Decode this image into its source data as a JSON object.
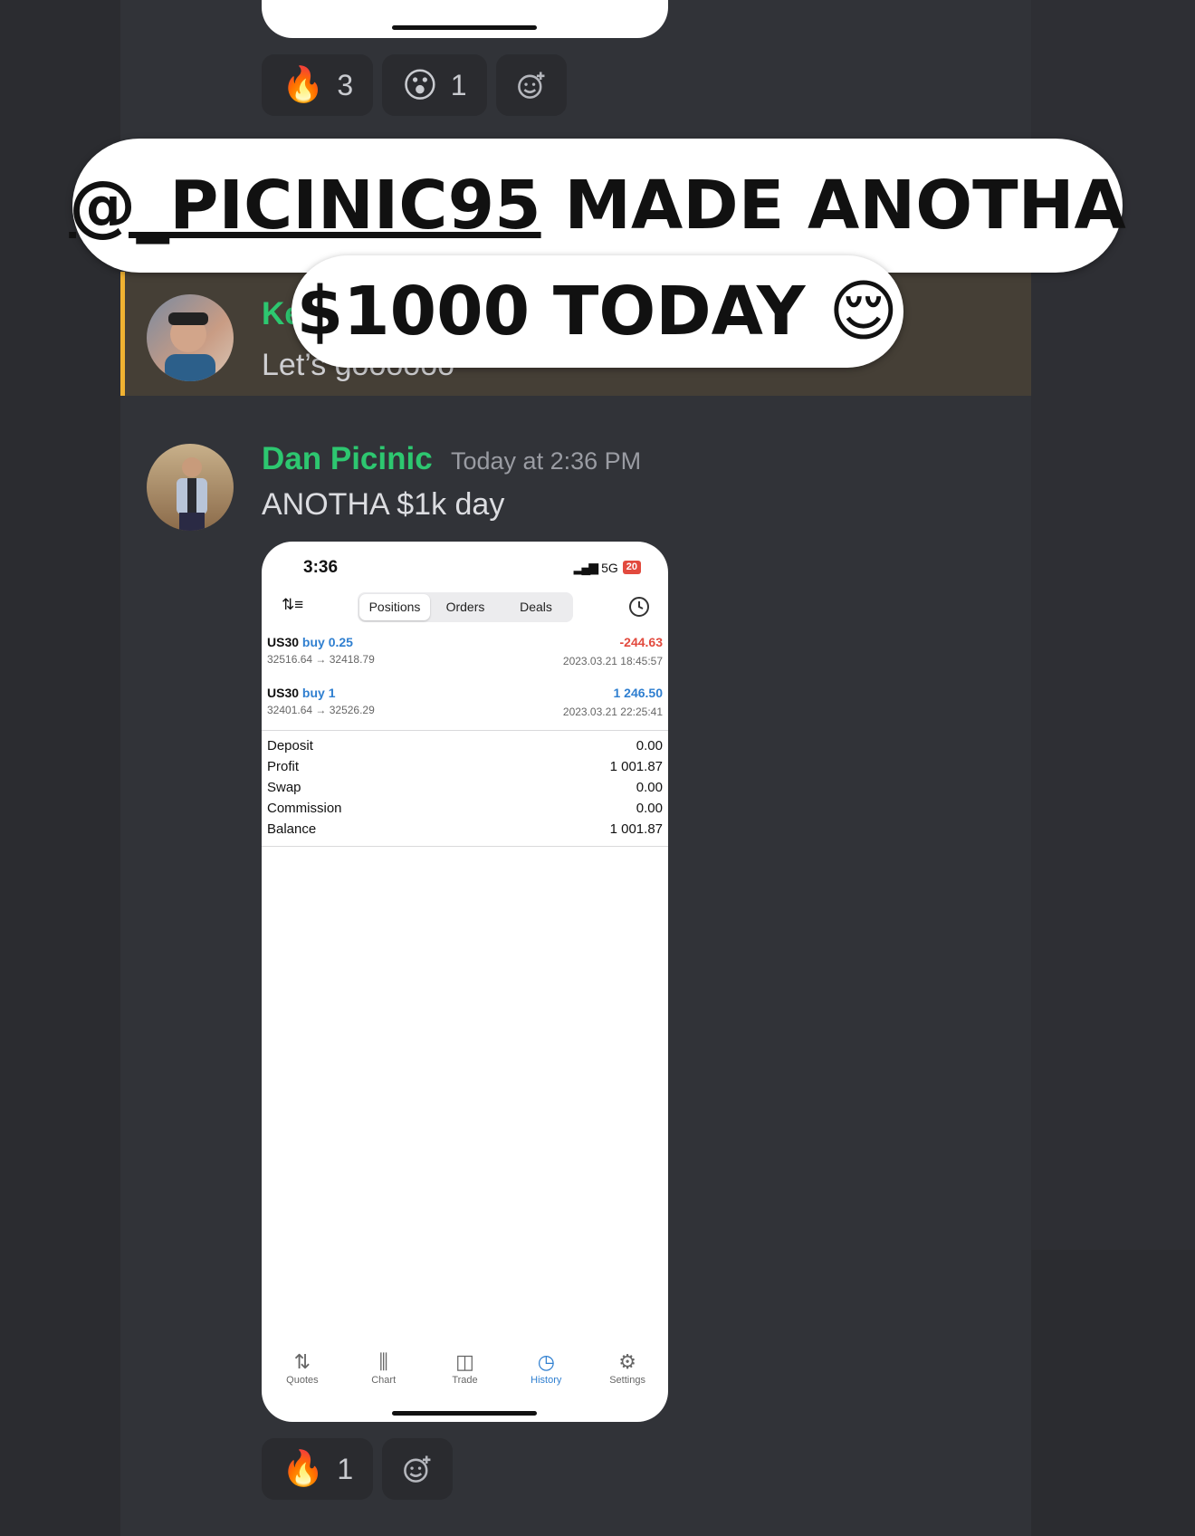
{
  "top_reactions": [
    {
      "emoji": "🔥",
      "icon": "fire-icon",
      "count": "3"
    },
    {
      "emoji": "😮",
      "icon": "surprised-face-icon",
      "count": "1"
    }
  ],
  "overlay": {
    "mention": "@_PICINIC95",
    "line1_rest": " MADE ANOTHA",
    "line2": "$1000 TODAY 😌"
  },
  "quoted_message": {
    "author_partial": "Ke",
    "text": "Let’s goooooo"
  },
  "message": {
    "author": "Dan Picinic",
    "timestamp": "Today at 2:36 PM",
    "text": "ANOTHA $1k day"
  },
  "phone": {
    "status_time": "3:36",
    "network": "5G",
    "battery": "20",
    "tabs": [
      "Positions",
      "Orders",
      "Deals"
    ],
    "active_tab": "Positions",
    "positions": [
      {
        "symbol": "US30",
        "side": "buy 0.25",
        "prices": "32516.64 → 32418.79",
        "profit": "-244.63",
        "time": "2023.03.21 18:45:57",
        "profit_color": "#e24a3e"
      },
      {
        "symbol": "US30",
        "side": "buy 1",
        "prices": "32401.64 → 32526.29",
        "profit": "1 246.50",
        "time": "2023.03.21 22:25:41",
        "profit_color": "#2f7fd0"
      }
    ],
    "summary": [
      {
        "label": "Deposit",
        "value": "0.00"
      },
      {
        "label": "Profit",
        "value": "1 001.87"
      },
      {
        "label": "Swap",
        "value": "0.00"
      },
      {
        "label": "Commission",
        "value": "0.00"
      },
      {
        "label": "Balance",
        "value": "1 001.87"
      }
    ],
    "nav": [
      {
        "label": "Quotes",
        "icon": "quotes-icon"
      },
      {
        "label": "Chart",
        "icon": "chart-icon"
      },
      {
        "label": "Trade",
        "icon": "trade-icon"
      },
      {
        "label": "History",
        "icon": "history-icon",
        "active": true
      },
      {
        "label": "Settings",
        "icon": "settings-icon"
      }
    ]
  },
  "bottom_reactions": [
    {
      "emoji": "🔥",
      "icon": "fire-icon",
      "count": "1"
    }
  ],
  "colors": {
    "username_green": "#2dc770",
    "quote_bar": "#f0b232",
    "profit_red": "#e24a3e",
    "accent_blue": "#2f7fd0"
  }
}
